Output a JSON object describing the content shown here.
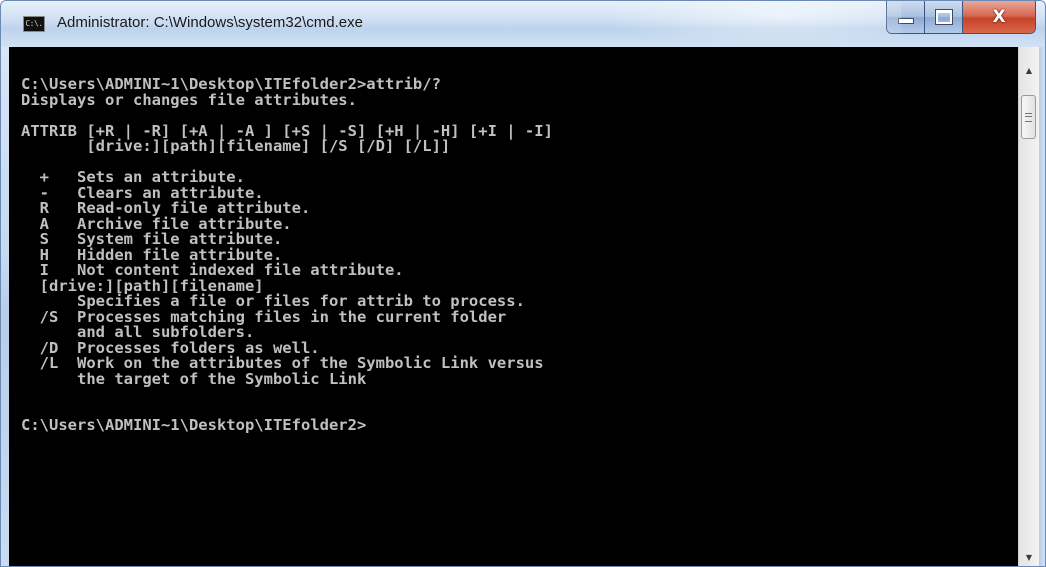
{
  "window": {
    "title": "Administrator: C:\\Windows\\system32\\cmd.exe",
    "icon_text": "C:\\."
  },
  "controls": {
    "minimize_icon": "minimize-icon",
    "maximize_icon": "maximize-icon",
    "close_glyph": "X"
  },
  "console": {
    "text": "C:\\Users\\ADMINI~1\\Desktop\\ITEfolder2>attrib/?\nDisplays or changes file attributes.\n\nATTRIB [+R | -R] [+A | -A ] [+S | -S] [+H | -H] [+I | -I]\n       [drive:][path][filename] [/S [/D] [/L]]\n\n  +   Sets an attribute.\n  -   Clears an attribute.\n  R   Read-only file attribute.\n  A   Archive file attribute.\n  S   System file attribute.\n  H   Hidden file attribute.\n  I   Not content indexed file attribute.\n  [drive:][path][filename]\n      Specifies a file or files for attrib to process.\n  /S  Processes matching files in the current folder\n      and all subfolders.\n  /D  Processes folders as well.\n  /L  Work on the attributes of the Symbolic Link versus\n      the target of the Symbolic Link\n\n\nC:\\Users\\ADMINI~1\\Desktop\\ITEfolder2>"
  },
  "scrollbar": {
    "up_arrow": "▲",
    "down_arrow": "▼"
  }
}
